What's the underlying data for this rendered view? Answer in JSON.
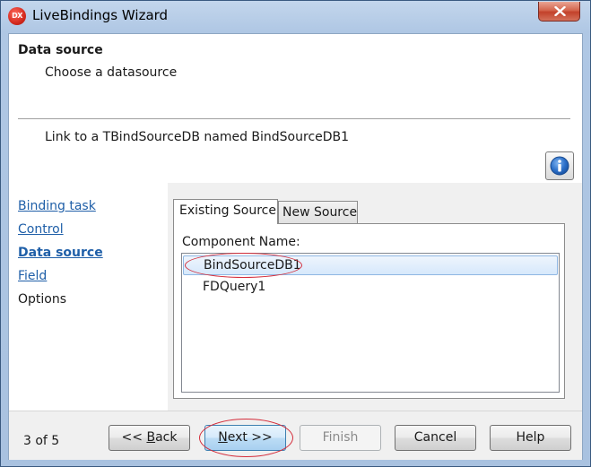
{
  "window": {
    "title": "LiveBindings Wizard",
    "icon_text": "DX",
    "icon": "delphi-app-icon"
  },
  "header": {
    "title": "Data source",
    "subtitle": "Choose a datasource",
    "description": "Link to a TBindSourceDB named BindSourceDB1",
    "info_icon": "info-icon"
  },
  "steps": {
    "items": [
      {
        "label": "Binding task",
        "state": "link"
      },
      {
        "label": "Control",
        "state": "link"
      },
      {
        "label": "Data source",
        "state": "current"
      },
      {
        "label": "Field",
        "state": "link"
      },
      {
        "label": "Options",
        "state": "plain"
      }
    ]
  },
  "tabs": {
    "items": [
      {
        "label": "Existing Source",
        "active": true
      },
      {
        "label": "New Source",
        "active": false
      }
    ]
  },
  "existing_source": {
    "label": "Component Name:",
    "components": [
      {
        "name": "BindSourceDB1",
        "selected": true
      },
      {
        "name": "FDQuery1",
        "selected": false
      }
    ]
  },
  "footer": {
    "page_counter": "3 of 5",
    "back_prefix": "<< ",
    "back_hotkey": "B",
    "back_rest": "ack",
    "next_hotkey": "N",
    "next_rest": "ext >>",
    "finish": "Finish",
    "cancel": "Cancel",
    "help": "Help"
  },
  "colors": {
    "link": "#1f5fa8",
    "highlight_ring": "#d42c3a",
    "selection": "#d6e8fb"
  }
}
